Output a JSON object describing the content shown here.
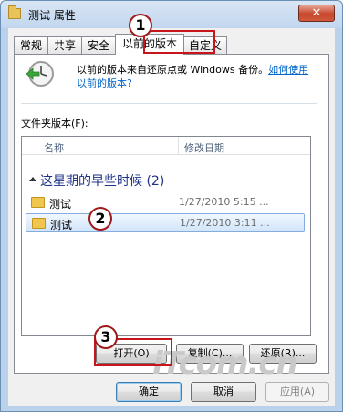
{
  "window": {
    "title": "测试 属性",
    "close_glyph": "✕"
  },
  "tabs": [
    {
      "label": "常规"
    },
    {
      "label": "共享"
    },
    {
      "label": "安全"
    },
    {
      "label": "以前的版本"
    },
    {
      "label": "自定义"
    }
  ],
  "header": {
    "description": "以前的版本来自还原点或 Windows 备份。",
    "link_text": "如何使用以前的版本?"
  },
  "versions_label": "文件夹版本(F):",
  "list": {
    "col_name": "名称",
    "col_date": "修改日期",
    "group_label": "这星期的早些时候 (2)",
    "rows": [
      {
        "name": "测试",
        "date": "1/27/2010 5:15 ..."
      },
      {
        "name": "测试",
        "date": "1/27/2010 3:11 ..."
      }
    ]
  },
  "actions": {
    "open": "打开(O)",
    "copy": "复制(C)...",
    "restore": "还原(R)..."
  },
  "footer": {
    "ok": "确定",
    "cancel": "取消",
    "apply": "应用(A)"
  },
  "callouts": [
    "1",
    "2",
    "3"
  ],
  "watermark": "iTcom.cn"
}
